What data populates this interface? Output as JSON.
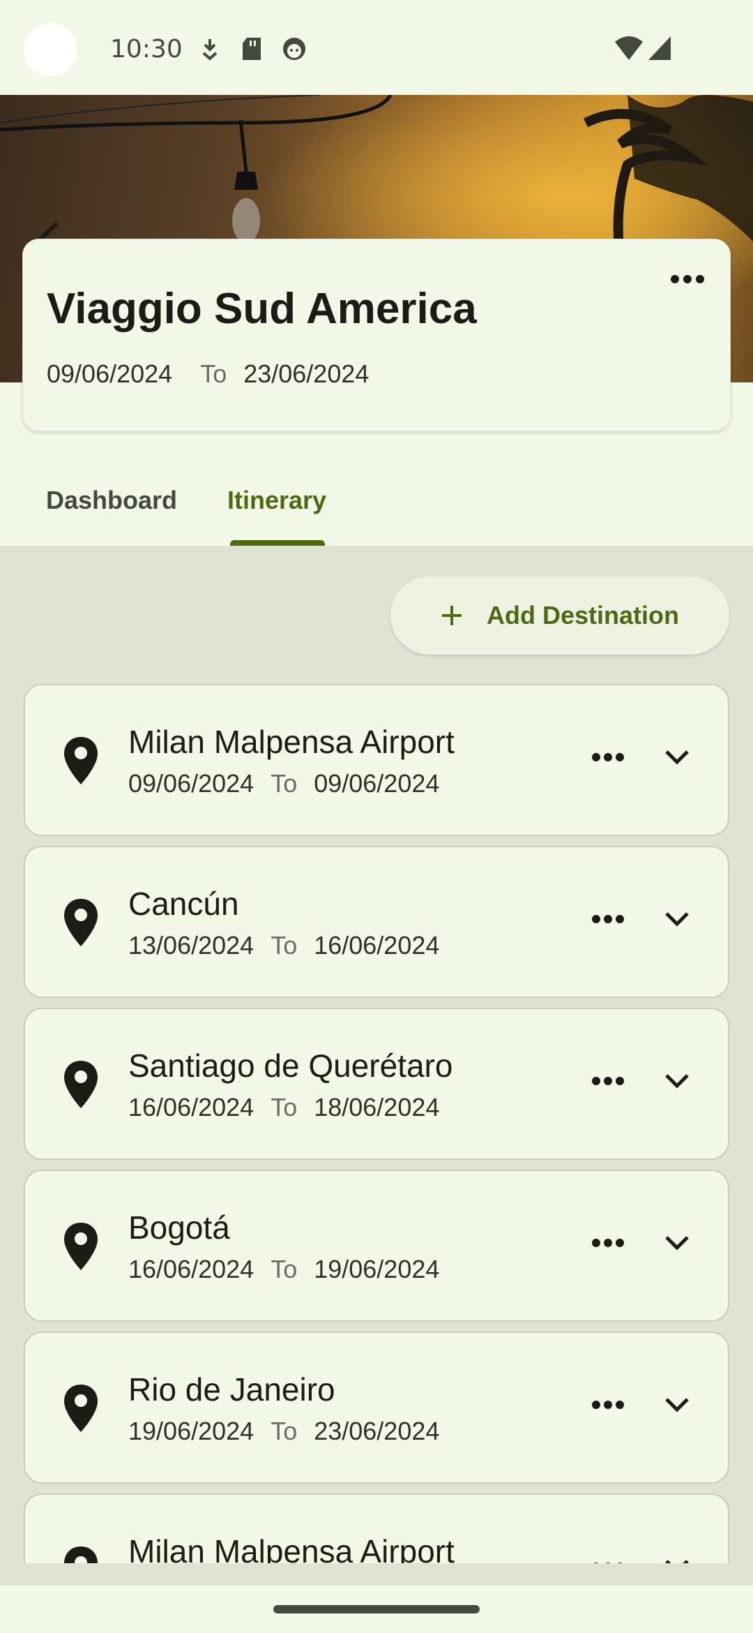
{
  "status_bar": {
    "time": "10:30",
    "icons": [
      "download-arrow-icon",
      "sd-card-icon",
      "face-icon",
      "wifi-icon",
      "signal-icon"
    ]
  },
  "trip": {
    "title": "Viaggio Sud America",
    "start_date": "09/06/2024",
    "to_label": "To",
    "end_date": "23/06/2024"
  },
  "tabs": [
    {
      "label": "Dashboard",
      "selected": false
    },
    {
      "label": "Itinerary",
      "selected": true
    }
  ],
  "add_destination": {
    "icon": "plus-icon",
    "label": "Add Destination"
  },
  "destinations": [
    {
      "name": "Milan Malpensa Airport",
      "from": "09/06/2024",
      "to_label": "To",
      "to": "09/06/2024"
    },
    {
      "name": "Cancún",
      "from": "13/06/2024",
      "to_label": "To",
      "to": "16/06/2024"
    },
    {
      "name": "Santiago de Querétaro",
      "from": "16/06/2024",
      "to_label": "To",
      "to": "18/06/2024"
    },
    {
      "name": "Bogotá",
      "from": "16/06/2024",
      "to_label": "To",
      "to": "19/06/2024"
    },
    {
      "name": "Rio de Janeiro",
      "from": "19/06/2024",
      "to_label": "To",
      "to": "23/06/2024"
    },
    {
      "name": "Milan Malpensa Airport",
      "from": "",
      "to_label": "",
      "to": ""
    }
  ],
  "colors": {
    "accent": "#4c6a10",
    "surface": "#f4f8e8",
    "background": "#e0e2d4"
  }
}
